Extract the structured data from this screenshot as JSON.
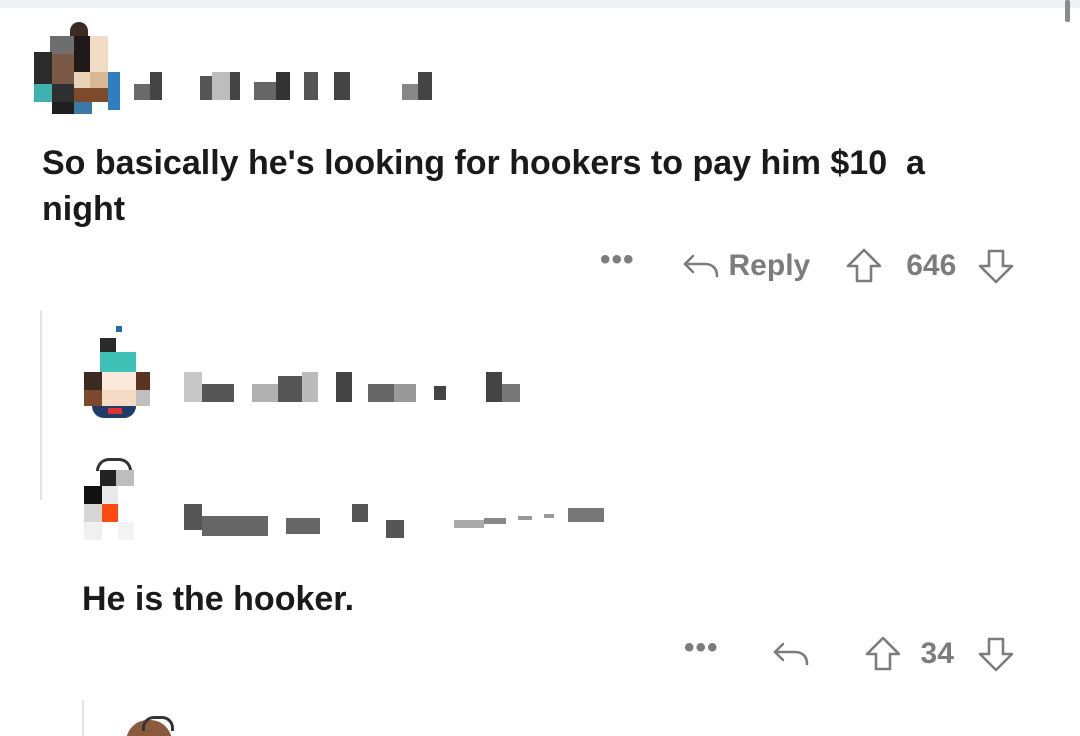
{
  "comments": [
    {
      "text": "So basically he's looking for hookers to pay him $10  a\nnight",
      "more_label": "•••",
      "reply_label": "Reply",
      "score": "646"
    },
    {
      "text": "He is the hooker.",
      "more_label": "•••",
      "reply_label": "",
      "score": "34"
    }
  ],
  "icons": {
    "more": "more-dots-icon",
    "reply": "reply-arrow-icon",
    "upvote": "upvote-arrow-icon",
    "downvote": "downvote-arrow-icon"
  },
  "colors": {
    "text": "#1a1a1b",
    "meta": "#7c7c7c",
    "thread_line": "#e4e4e4"
  }
}
